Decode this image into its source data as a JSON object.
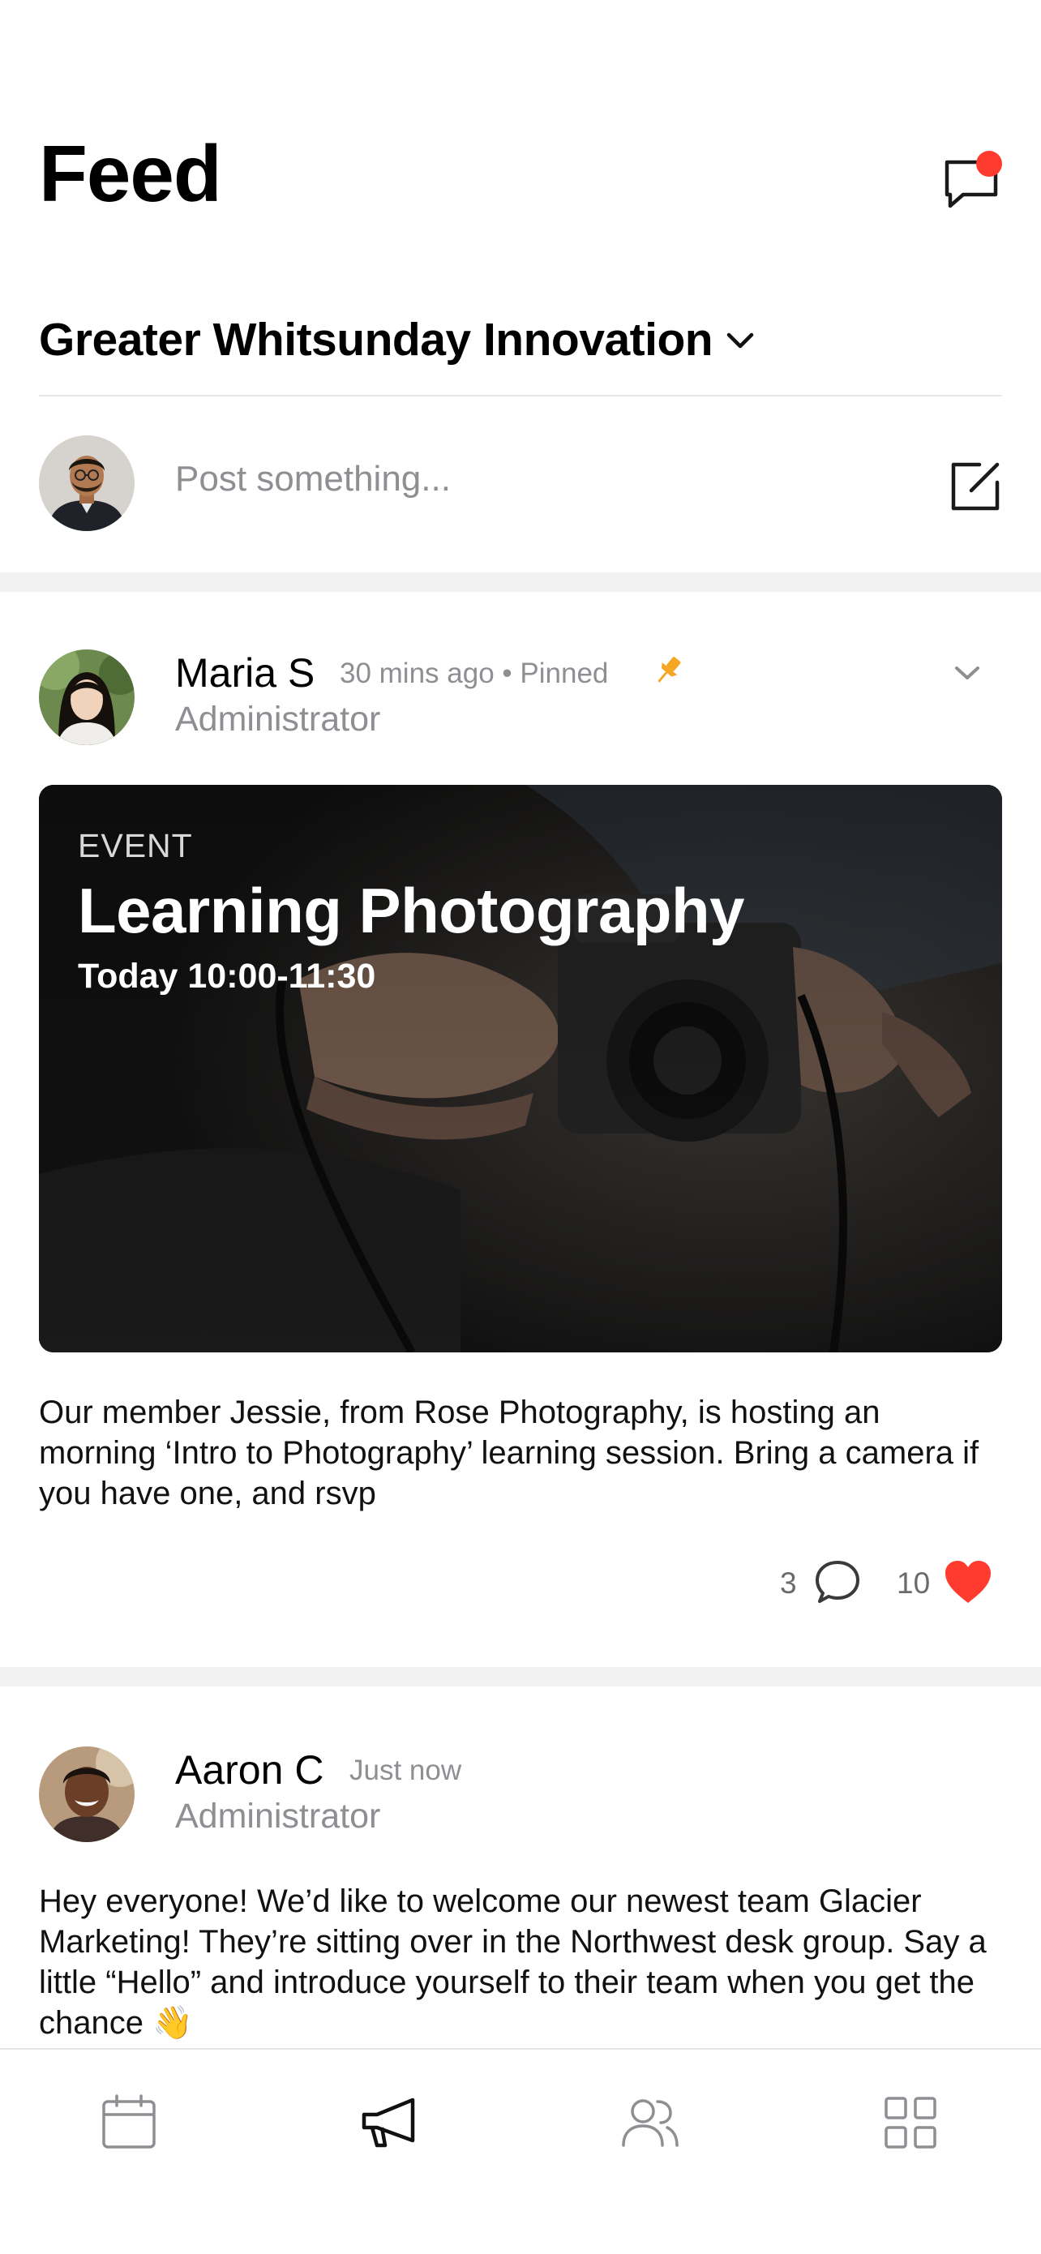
{
  "header": {
    "title": "Feed",
    "messages_icon": "chat-bubble-icon",
    "notification_color": "#ff3b30"
  },
  "org": {
    "name": "Greater Whitsunday Innovation",
    "dropdown_icon": "chevron-down-icon"
  },
  "composer": {
    "placeholder": "Post something...",
    "compose_icon": "compose-icon"
  },
  "posts": [
    {
      "author": "Maria S",
      "time": "30 mins ago",
      "pinned_label": "Pinned",
      "role": "Administrator",
      "event": {
        "label": "EVENT",
        "title": "Learning Photography",
        "time": "Today 10:00-11:30"
      },
      "body": "Our member Jessie, from Rose Photography, is hosting an morning ‘Intro to Photography’ learning session. Bring a camera if you have one, and rsvp",
      "comments": "3",
      "likes": "10",
      "pin_color": "#f5a623",
      "like_color": "#ff3b30"
    },
    {
      "author": "Aaron C",
      "time": "Just now",
      "role": "Administrator",
      "body": "Hey everyone! We’d like to welcome our newest team Glacier Marketing! They’re sitting over in the Northwest desk group. Say a little “Hello” and introduce yourself to their team when you get the chance 👋"
    }
  ],
  "tabbar": {
    "tabs": [
      {
        "icon": "calendar-icon",
        "active": false
      },
      {
        "icon": "megaphone-icon",
        "active": true
      },
      {
        "icon": "people-icon",
        "active": false
      },
      {
        "icon": "grid-icon",
        "active": false
      }
    ]
  }
}
